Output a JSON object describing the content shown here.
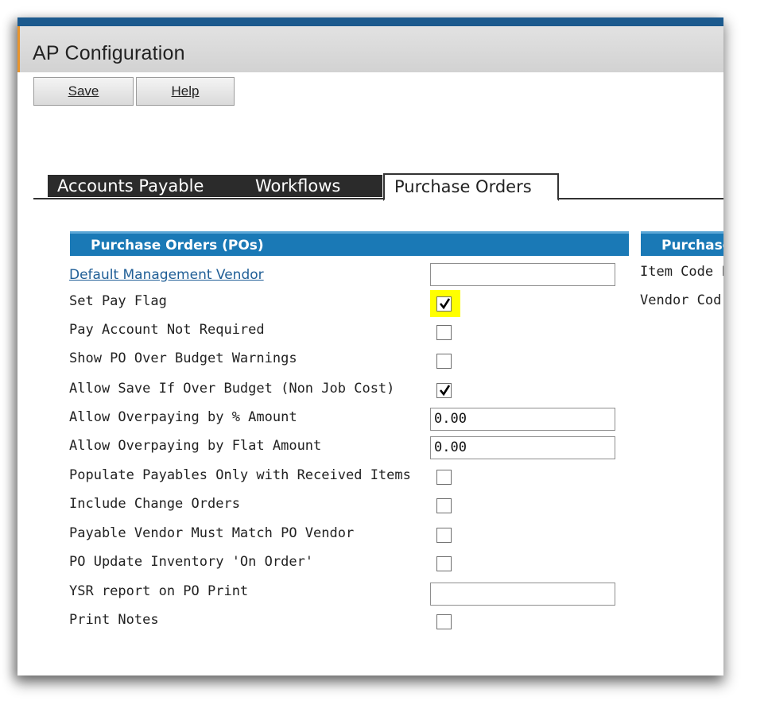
{
  "window": {
    "title": "AP Configuration"
  },
  "toolbar": {
    "save_label": "Save",
    "help_label": "Help"
  },
  "tabs": [
    {
      "label": "Accounts Payable",
      "active": false
    },
    {
      "label": "Workflows",
      "active": false
    },
    {
      "label": "Purchase Orders",
      "active": true
    }
  ],
  "sections": {
    "left_header": "Purchase Orders (POs)",
    "right_header": "Purchase",
    "right_items": [
      "Item Code F",
      "Vendor Cod"
    ]
  },
  "fields": {
    "default_management_vendor": {
      "label": "Default Management Vendor",
      "value": ""
    },
    "set_pay_flag": {
      "label": "Set Pay Flag",
      "checked": true,
      "highlighted": true
    },
    "pay_account_not_required": {
      "label": "Pay Account Not Required",
      "checked": false
    },
    "show_po_over_budget_warnings": {
      "label": "Show PO Over Budget Warnings",
      "checked": false
    },
    "allow_save_if_over_budget": {
      "label": "Allow Save If Over Budget (Non Job Cost)",
      "checked": true
    },
    "allow_overpaying_percent": {
      "label": "Allow Overpaying by % Amount",
      "value": "0.00"
    },
    "allow_overpaying_flat": {
      "label": "Allow Overpaying by Flat Amount",
      "value": "0.00"
    },
    "populate_payables_received": {
      "label": "Populate Payables Only with Received Items",
      "checked": false
    },
    "include_change_orders": {
      "label": "Include Change Orders",
      "checked": false
    },
    "payable_vendor_match": {
      "label": "Payable Vendor Must Match PO Vendor",
      "checked": false
    },
    "po_update_inventory": {
      "label": "PO Update Inventory 'On Order'",
      "checked": false
    },
    "ysr_report_po_print": {
      "label": "YSR report on PO Print",
      "value": ""
    },
    "print_notes": {
      "label": "Print Notes",
      "checked": false
    }
  },
  "colors": {
    "section_header": "#1a79b6",
    "title_accent": "#e8942c",
    "top_bar": "#1c5a8e",
    "highlight": "#ffff00"
  }
}
